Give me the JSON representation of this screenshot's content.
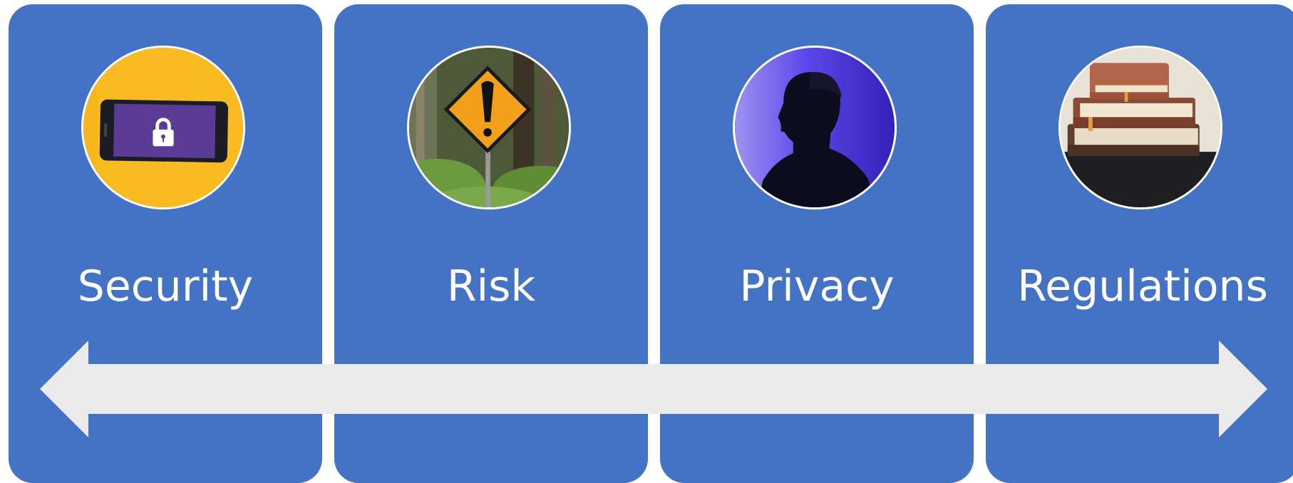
{
  "colors": {
    "card": "#4472c4",
    "arrow": "#ebebeb",
    "label": "#ffffff",
    "photo_border": "#ffffff"
  },
  "cards": [
    {
      "label": "Security",
      "icon": "phone-lock-icon"
    },
    {
      "label": "Risk",
      "icon": "warning-sign-icon"
    },
    {
      "label": "Privacy",
      "icon": "silhouette-icon"
    },
    {
      "label": "Regulations",
      "icon": "books-icon"
    }
  ],
  "arrow": {
    "direction": "bidirectional"
  }
}
